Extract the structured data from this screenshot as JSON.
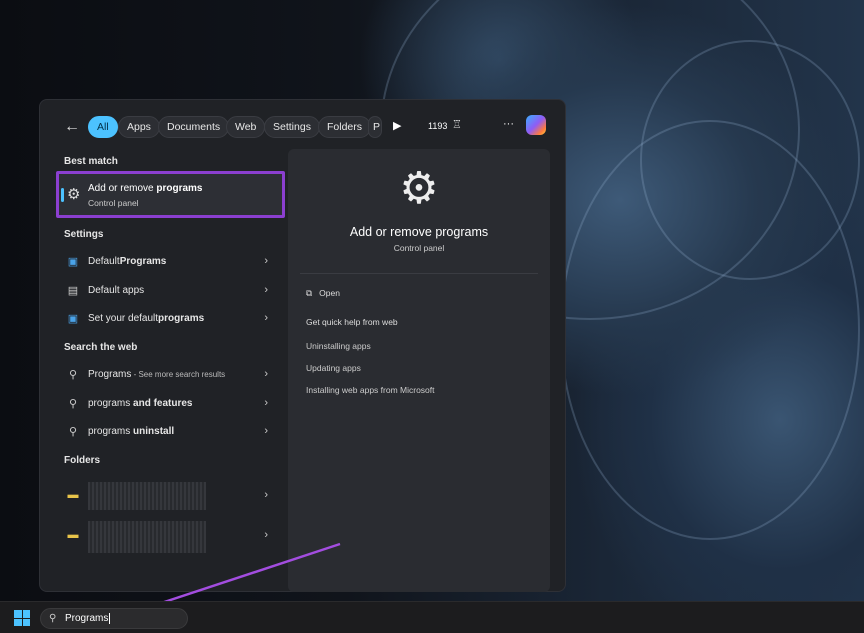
{
  "filters": {
    "back": "←",
    "chips": [
      "All",
      "Apps",
      "Documents",
      "Web",
      "Settings",
      "Folders",
      "P"
    ],
    "count": "1193",
    "more": "···"
  },
  "best_match": {
    "heading": "Best match",
    "title_plain": "Add or remove ",
    "title_bold": "programs",
    "subtitle": "Control panel"
  },
  "settings": {
    "heading": "Settings",
    "items": [
      {
        "plain": "Default ",
        "bold": "Programs"
      },
      {
        "plain": "Default apps",
        "bold": ""
      },
      {
        "plain": "Set your default ",
        "bold": "programs"
      }
    ]
  },
  "web": {
    "heading": "Search the web",
    "items": [
      {
        "plain": "Programs",
        "bold": "",
        "extra": " - See more search results"
      },
      {
        "plain": "programs",
        "bold": " and features",
        "extra": ""
      },
      {
        "plain": "programs",
        "bold": " uninstall",
        "extra": ""
      }
    ]
  },
  "folders": {
    "heading": "Folders"
  },
  "preview": {
    "title": "Add or remove programs",
    "subtitle": "Control panel",
    "open": "Open",
    "help_heading": "Get quick help from web",
    "links": [
      "Uninstalling apps",
      "Updating apps",
      "Installing web apps from Microsoft"
    ]
  },
  "taskbar": {
    "search_value": "Programs"
  },
  "colors": {
    "accent": "#4cc2ff",
    "highlight": "#8b3fd0"
  }
}
